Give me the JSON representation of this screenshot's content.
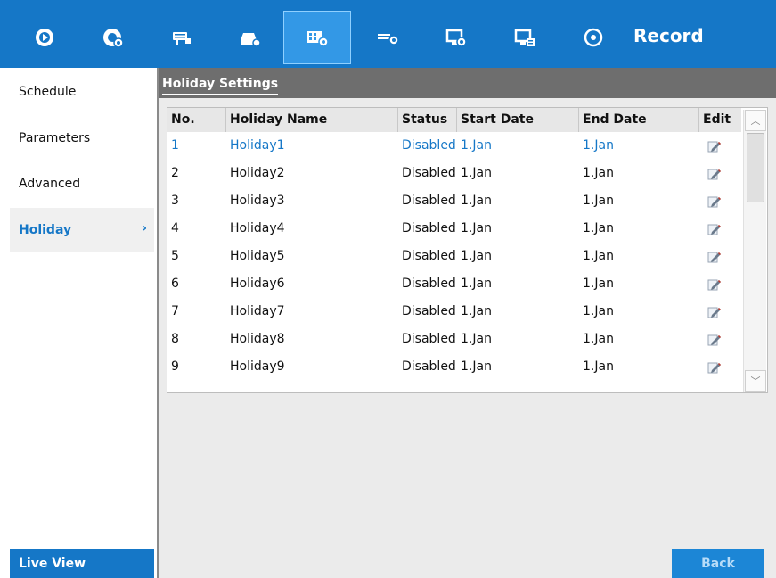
{
  "header": {
    "title": "Record",
    "icons": [
      {
        "name": "live-view-icon"
      },
      {
        "name": "playback-icon"
      },
      {
        "name": "camera-icon"
      },
      {
        "name": "storage-icon"
      },
      {
        "name": "record-settings-icon",
        "active": true
      },
      {
        "name": "network-icon"
      },
      {
        "name": "system-icon"
      },
      {
        "name": "maintenance-icon"
      },
      {
        "name": "shutdown-icon"
      }
    ]
  },
  "sidebar": {
    "items": [
      {
        "label": "Schedule"
      },
      {
        "label": "Parameters"
      },
      {
        "label": "Advanced"
      },
      {
        "label": "Holiday",
        "active": true
      }
    ],
    "active_marker": "›",
    "live_view_label": "Live View"
  },
  "main": {
    "tab_label": "Holiday Settings",
    "columns": [
      "No.",
      "Holiday Name",
      "Status",
      "Start Date",
      "End Date",
      "Edit"
    ],
    "rows": [
      {
        "no": "1",
        "name": "Holiday1",
        "status": "Disabled",
        "start": "1.Jan",
        "end": "1.Jan",
        "selected": true
      },
      {
        "no": "2",
        "name": "Holiday2",
        "status": "Disabled",
        "start": "1.Jan",
        "end": "1.Jan"
      },
      {
        "no": "3",
        "name": "Holiday3",
        "status": "Disabled",
        "start": "1.Jan",
        "end": "1.Jan"
      },
      {
        "no": "4",
        "name": "Holiday4",
        "status": "Disabled",
        "start": "1.Jan",
        "end": "1.Jan"
      },
      {
        "no": "5",
        "name": "Holiday5",
        "status": "Disabled",
        "start": "1.Jan",
        "end": "1.Jan"
      },
      {
        "no": "6",
        "name": "Holiday6",
        "status": "Disabled",
        "start": "1.Jan",
        "end": "1.Jan"
      },
      {
        "no": "7",
        "name": "Holiday7",
        "status": "Disabled",
        "start": "1.Jan",
        "end": "1.Jan"
      },
      {
        "no": "8",
        "name": "Holiday8",
        "status": "Disabled",
        "start": "1.Jan",
        "end": "1.Jan"
      },
      {
        "no": "9",
        "name": "Holiday9",
        "status": "Disabled",
        "start": "1.Jan",
        "end": "1.Jan"
      }
    ],
    "back_label": "Back"
  },
  "colors": {
    "accent": "#1577c7",
    "header_bg": "#1577c7",
    "tabbar_bg": "#6e6e6e",
    "panel_bg": "#ebebeb"
  }
}
